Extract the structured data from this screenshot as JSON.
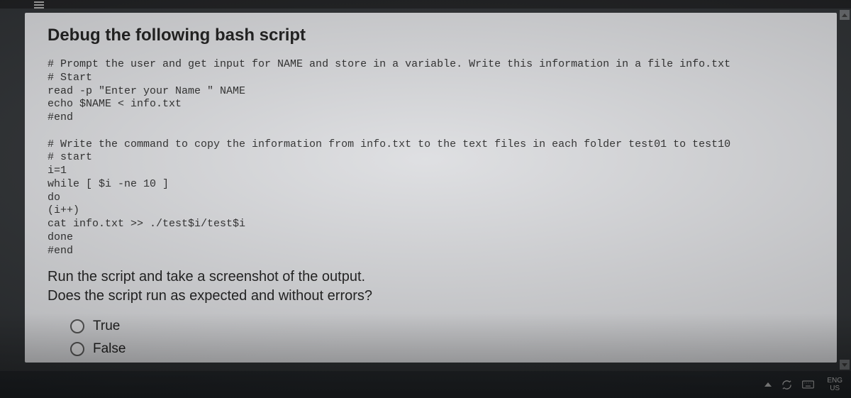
{
  "question": {
    "title": "Debug the following bash script",
    "code": "# Prompt the user and get input for NAME and store in a variable. Write this information in a file info.txt\n# Start\nread -p \"Enter your Name \" NAME\necho $NAME < info.txt\n#end\n\n# Write the command to copy the information from info.txt to the text files in each folder test01 to test10\n# start\ni=1\nwhile [ $i -ne 10 ]\ndo\n(i++)\ncat info.txt >> ./test$i/test$i\ndone\n#end",
    "instruction_line1": "Run the script and take a screenshot of the output.",
    "instruction_line2": "Does the script run as expected and without errors?",
    "options": {
      "true_label": "True",
      "false_label": "False"
    }
  },
  "taskbar": {
    "lang_top": "ENG",
    "lang_bottom": "US"
  }
}
